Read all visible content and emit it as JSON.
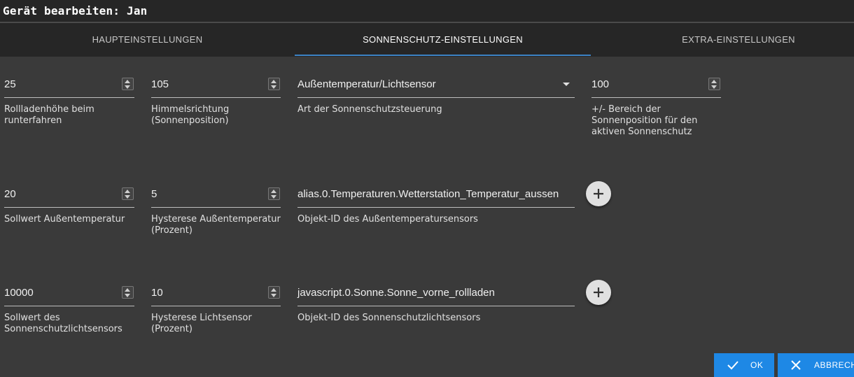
{
  "dialog": {
    "title": "Gerät bearbeiten: Jan"
  },
  "tabs": [
    {
      "label": "HAUPTEINSTELLUNGEN",
      "active": false
    },
    {
      "label": "SONNENSCHUTZ-EINSTELLUNGEN",
      "active": true
    },
    {
      "label": "EXTRA-EINSTELLUNGEN",
      "active": false
    }
  ],
  "rows": [
    {
      "fields": [
        {
          "value": "25",
          "helper": [
            "Rollladenhöhe beim",
            "runterfahren"
          ],
          "type": "number"
        },
        {
          "value": "105",
          "helper": [
            "Himmelsrichtung",
            "(Sonnenposition)"
          ],
          "type": "number"
        },
        {
          "value": "Außentemperatur/Lichtsensor",
          "helper": [
            "Art der Sonnenschutzsteuerung"
          ],
          "type": "select"
        },
        {
          "value": "100",
          "helper": [
            "+/- Bereich der",
            "Sonnenposition für den",
            "aktiven Sonnenschutz"
          ],
          "type": "number"
        }
      ]
    },
    {
      "fields": [
        {
          "value": "20",
          "helper": [
            "Sollwert Außentemperatur"
          ],
          "type": "number"
        },
        {
          "value": "5",
          "helper": [
            "Hysterese Außentemperatur",
            "(Prozent)"
          ],
          "type": "number"
        },
        {
          "value": "alias.0.Temperaturen.Wetterstation_Temperatur_aussen",
          "helper": [
            "Objekt-ID des Außentemperatursensors"
          ],
          "type": "text"
        }
      ]
    },
    {
      "fields": [
        {
          "value": "10000",
          "helper": [
            "Sollwert des",
            "Sonnenschutzlichtsensors"
          ],
          "type": "number"
        },
        {
          "value": "10",
          "helper": [
            "Hysterese Lichtsensor",
            "(Prozent)"
          ],
          "type": "number"
        },
        {
          "value": "javascript.0.Sonne.Sonne_vorne_rollladen",
          "helper": [
            "Objekt-ID des Sonnenschutzlichtsensors"
          ],
          "type": "text"
        }
      ]
    }
  ],
  "buttons": {
    "ok": "OK",
    "cancel": "ABBRECH"
  },
  "icons": {
    "add": "plus-icon",
    "ok": "check-icon",
    "cancel": "close-icon",
    "select": "caret-down-icon",
    "spinner": "spinner-arrows-icon"
  },
  "colors": {
    "accent": "#1e88e5",
    "tab_indicator": "#3b82c4",
    "background": "#3a3a3a",
    "header": "#262626"
  }
}
